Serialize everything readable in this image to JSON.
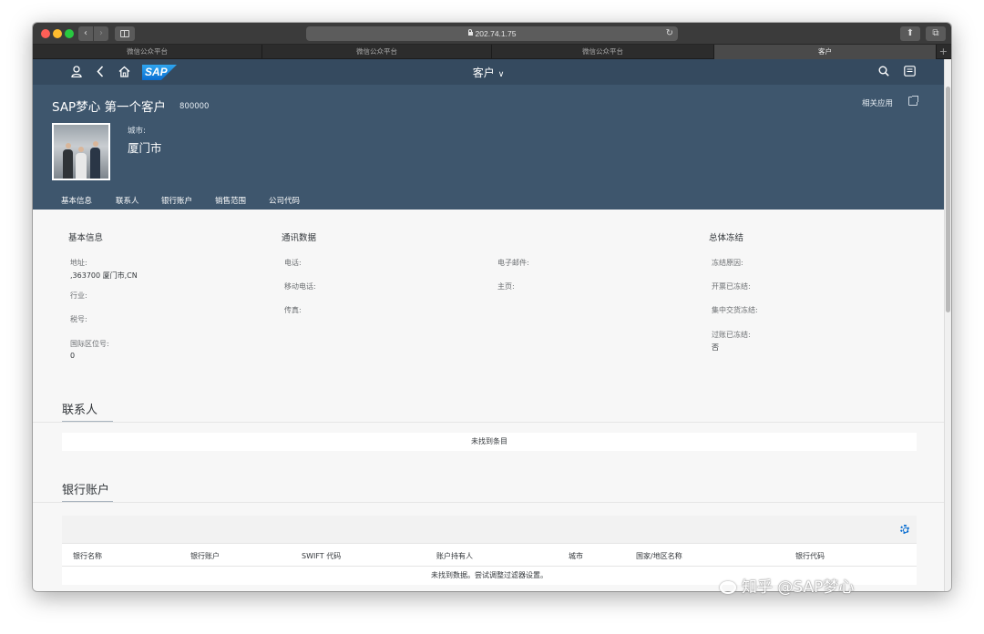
{
  "browser": {
    "url": "202.74.1.75",
    "tabs": [
      {
        "label": "微信公众平台"
      },
      {
        "label": "微信公众平台"
      },
      {
        "label": "微信公众平台"
      },
      {
        "label": "客户"
      }
    ]
  },
  "shell": {
    "app_title": "客户",
    "logo_text": "SAP"
  },
  "header": {
    "title": "SAP梦心 第一个客户",
    "number": "800000",
    "related_apps": "相关应用",
    "city_label": "城市:",
    "city_value": "厦门市",
    "section_tabs": [
      "基本信息",
      "联系人",
      "银行账户",
      "销售范围",
      "公司代码"
    ]
  },
  "basic_info": {
    "title": "基本信息",
    "address_label": "地址:",
    "address_value": ",363700 厦门市,CN",
    "industry_label": "行业:",
    "tax_label": "税号:",
    "location_label": "国际区位号:",
    "location_value": "0"
  },
  "communication": {
    "title": "通讯数据",
    "phone_label": "电话:",
    "mobile_label": "移动电话:",
    "fax_label": "传真:",
    "email_label": "电子邮件:",
    "homepage_label": "主页:"
  },
  "blocking": {
    "title": "总体冻结",
    "reason_label": "冻结原因:",
    "billing_label": "开票已冻结:",
    "delivery_label": "集中交货冻结:",
    "posting_label": "过账已冻结:",
    "posting_value": "否"
  },
  "contacts": {
    "title": "联系人",
    "empty_text": "未找到条目"
  },
  "bank_accounts": {
    "title": "银行账户",
    "columns": [
      "银行名称",
      "银行账户",
      "SWIFT 代码",
      "账户持有人",
      "城市",
      "国家/地区名称",
      "银行代码"
    ],
    "empty_text": "未找到数据。尝试调整过滤器设置。"
  },
  "watermark": "知乎 @SAP梦心"
}
